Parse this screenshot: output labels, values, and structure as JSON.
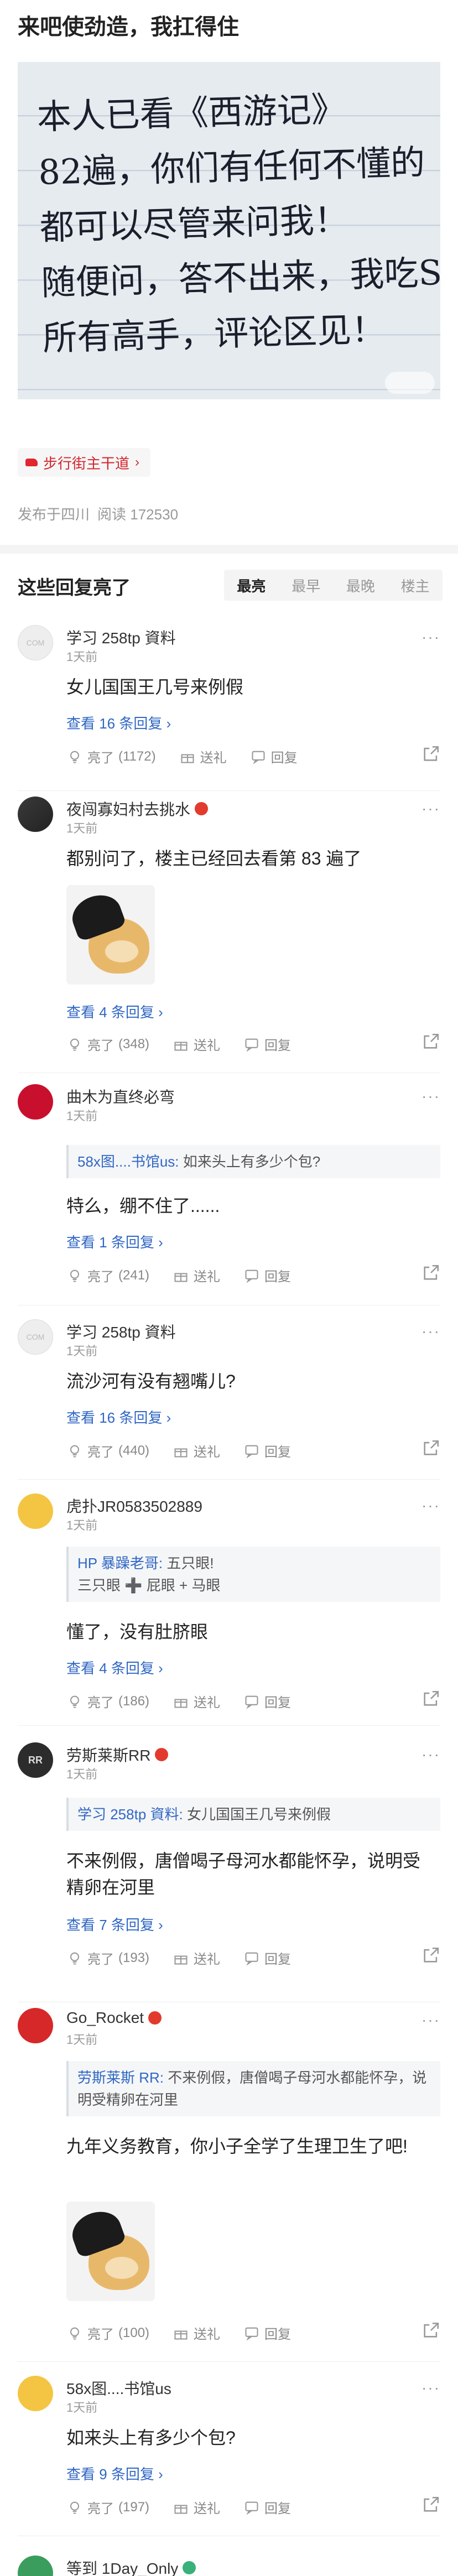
{
  "post": {
    "title": "来吧使劲造，我扛得住",
    "image_text": "本人已看《西游记》\n82遍，你们有任何不懂的\n都可以尽管来问我！\n随便问，答不出来，我吃S\n所有高手，评论区见！",
    "topic_tag": "步行街主干道",
    "location": "发布于四川",
    "read_label": "阅读",
    "read_count": "172530"
  },
  "section": {
    "title": "这些回复亮了",
    "sort_tabs": [
      "最亮",
      "最早",
      "最晚",
      "楼主"
    ],
    "active_tab": "最亮"
  },
  "actions": {
    "like_prefix": "亮了",
    "gift": "送礼",
    "reply": "回复"
  },
  "comments": [
    {
      "user": "学习 258tp 資料",
      "time": "1天前",
      "text": "女儿国国王几号来例假",
      "replies": "查看 16 条回复 ›",
      "likes": "(1172)",
      "avatar": "COM"
    },
    {
      "user": "夜闯寡妇村去挑水",
      "time": "1天前",
      "text": "都别问了，楼主已经回去看第 83 遍了",
      "replies": "查看 4 条回复 ›",
      "likes": "(348)"
    },
    {
      "user": "曲木为直终必弯",
      "time": "1天前",
      "quote_name": "58x图....书馆us:",
      "quote_text": " 如来头上有多少个包?",
      "text": "特么，绷不住了......",
      "replies": "查看 1 条回复 ›",
      "likes": "(241)"
    },
    {
      "user": "学习 258tp 資料",
      "time": "1天前",
      "text": "流沙河有没有翘嘴儿?",
      "replies": "查看 16 条回复 ›",
      "likes": "(440)",
      "avatar": "COM"
    },
    {
      "user": "虎扑JR0583502889",
      "time": "1天前",
      "quote_name": "HP 暴躁老哥:",
      "quote_text": " 五只眼!",
      "quote_line2": "三只眼 ➕ 屁眼 + 马眼",
      "text": "懂了，没有肚脐眼",
      "replies": "查看 4 条回复 ›",
      "likes": "(186)"
    },
    {
      "user": "劳斯莱斯RR",
      "time": "1天前",
      "quote_name": "学习 258tp 資料:",
      "quote_text": " 女儿国国王几号来例假",
      "text": "不来例假，唐僧喝子母河水都能怀孕，说明受精卵在河里",
      "replies": "查看 7 条回复 ›",
      "likes": "(193)",
      "avatar": "RR"
    },
    {
      "user": "Go_Rocket",
      "time": "1天前",
      "quote_name": "劳斯莱斯 RR:",
      "quote_text": " 不来例假，唐僧喝子母河水都能怀孕，说明受精卵在河里",
      "text": "九年义务教育，你小子全学了生理卫生了吧!",
      "likes": "(100)"
    },
    {
      "user": "58x图....书馆us",
      "time": "1天前",
      "text": "如来头上有多少个包?",
      "replies": "查看 9 条回复 ›",
      "likes": "(197)"
    },
    {
      "user": "等到 1Day_Only"
    }
  ],
  "colors": {
    "link_blue": "#3067c4",
    "tag_red": "#d4262e",
    "muted": "#999999"
  }
}
